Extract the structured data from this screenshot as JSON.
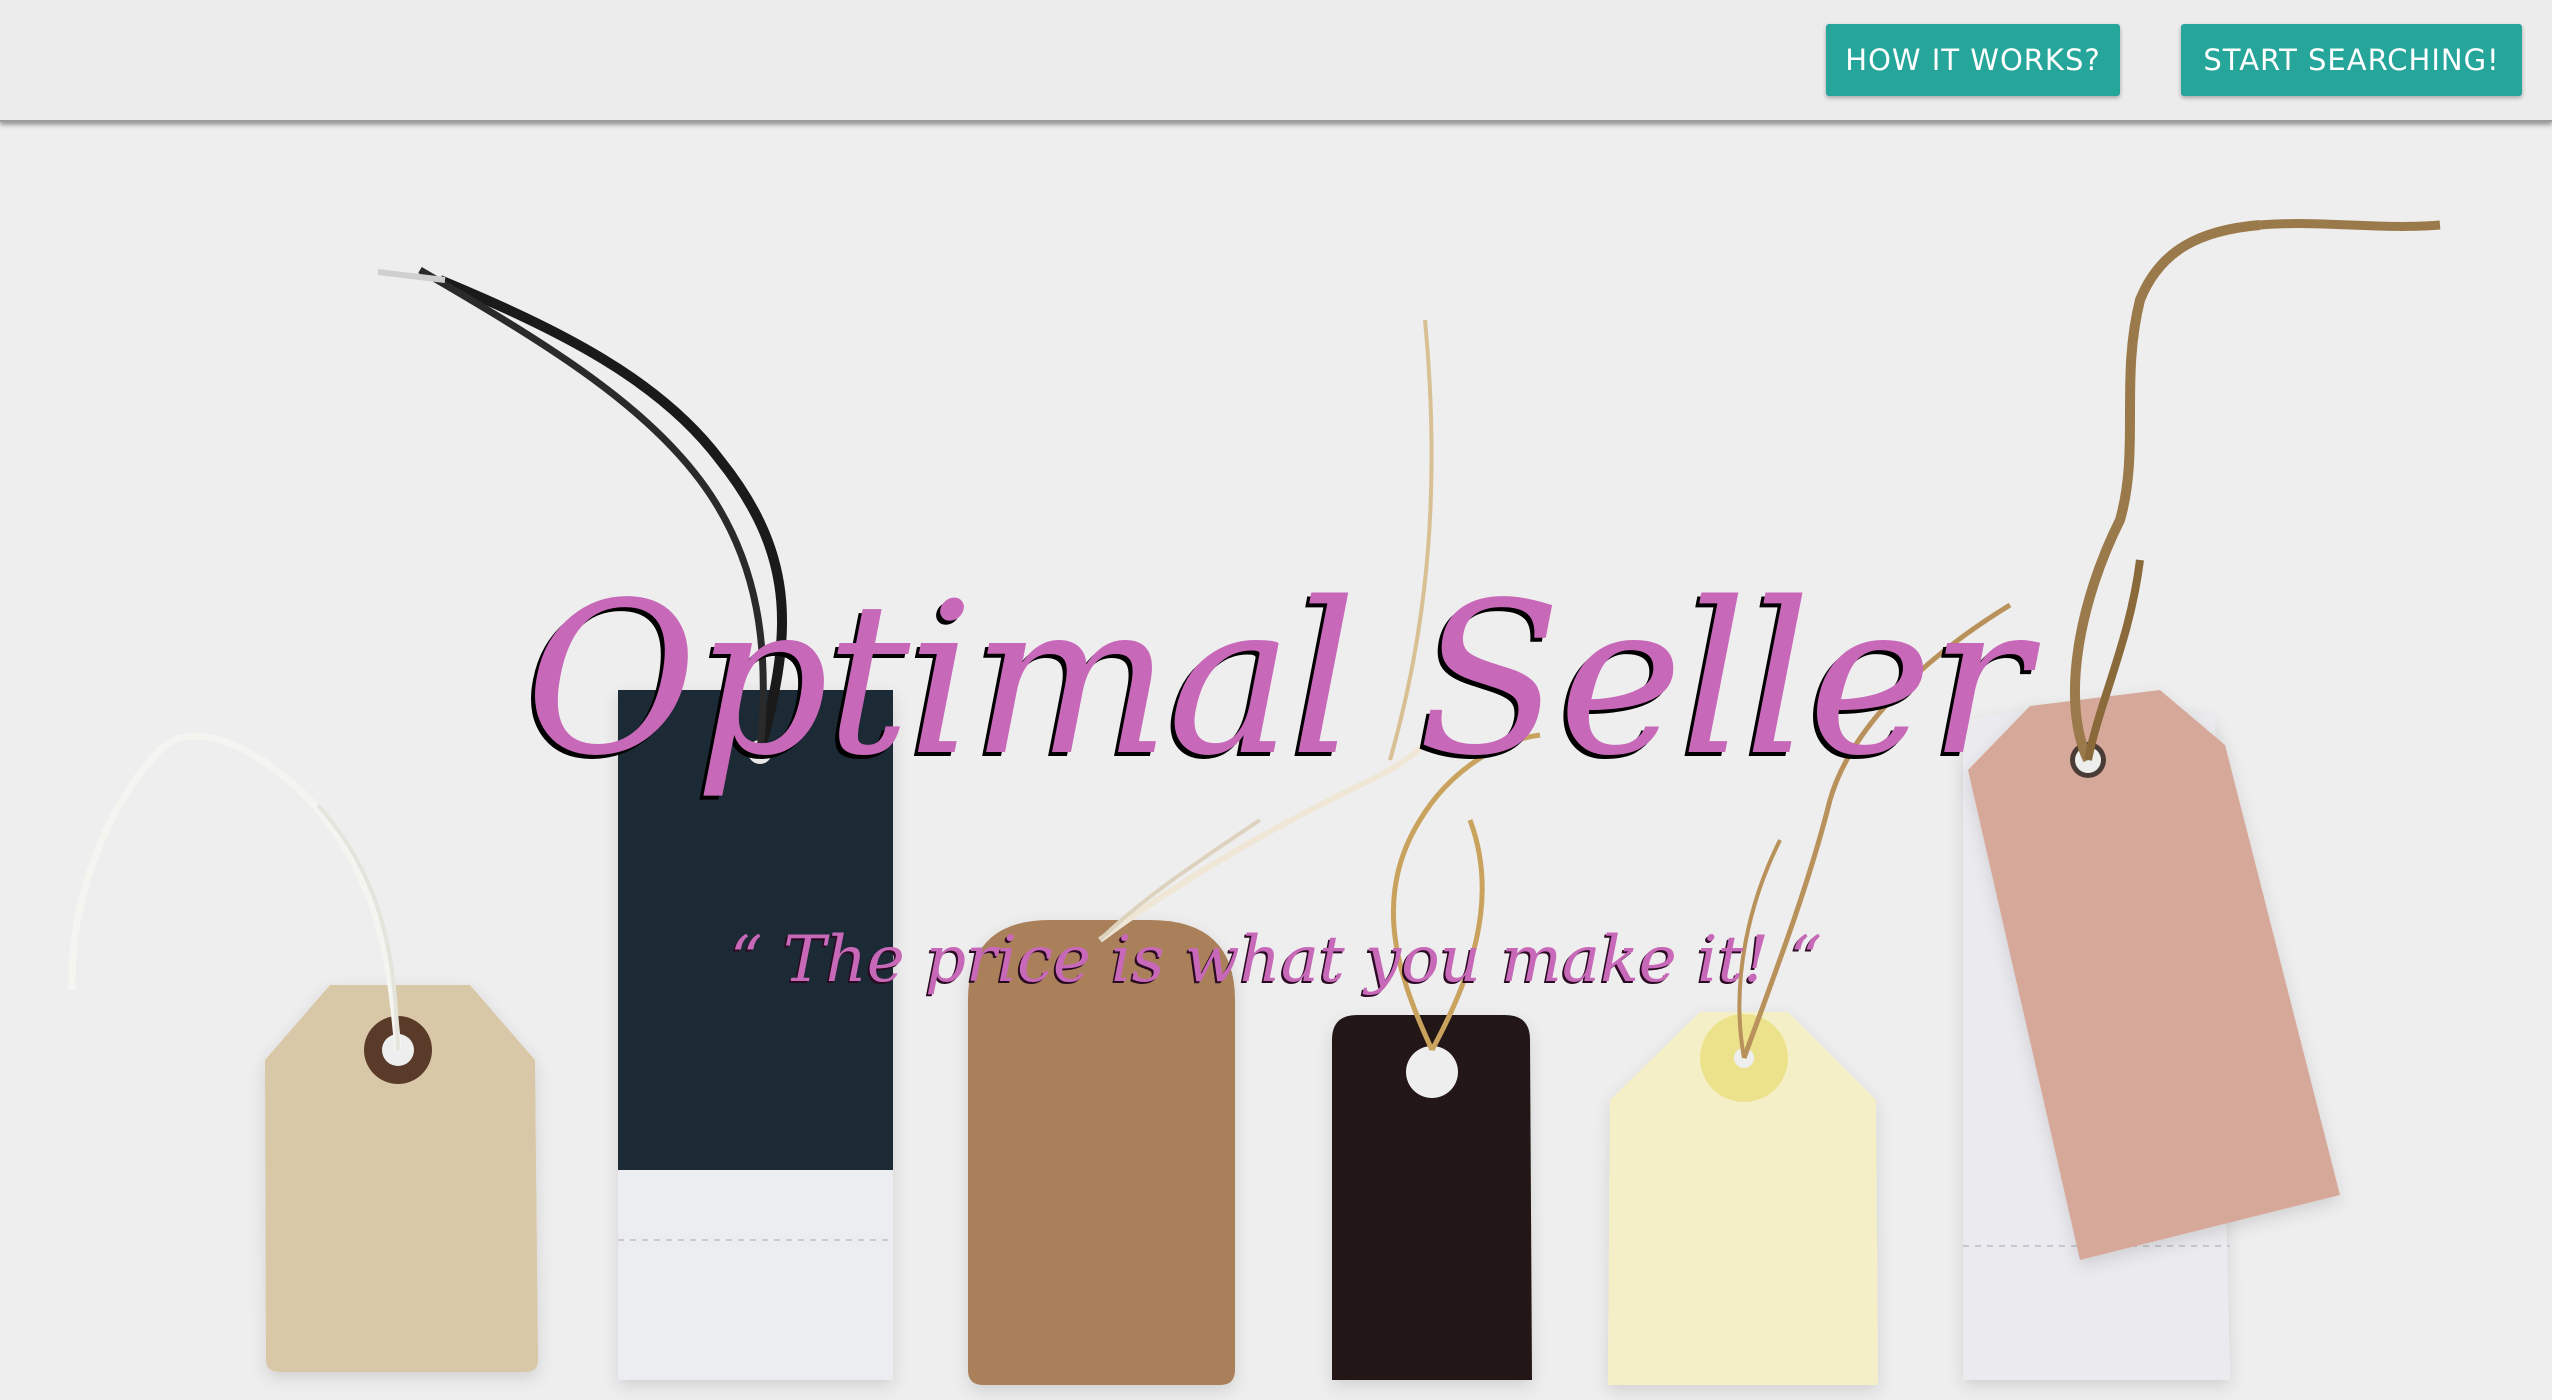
{
  "nav": {
    "how_it_works_label": "HOW IT WORKS?",
    "start_searching_label": "START SEARCHING!"
  },
  "hero": {
    "title": "Optimal Seller",
    "tagline": "“ The price is what you make it! “"
  },
  "colors": {
    "accent": "#26a69a",
    "title": "#c868b8",
    "background": "#efefef"
  }
}
